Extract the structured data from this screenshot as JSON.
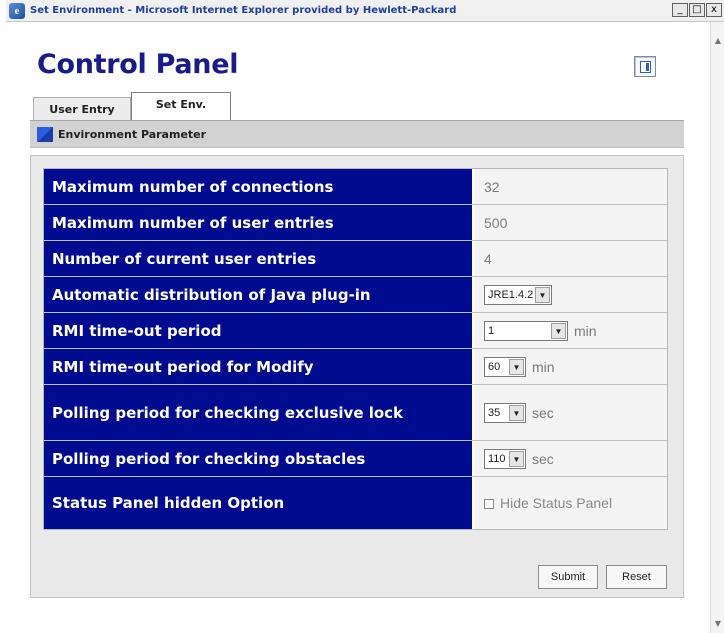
{
  "window": {
    "title": "Set Environment - Microsoft Internet Explorer provided by Hewlett-Packard",
    "min_label": "_",
    "max_label": "□",
    "close_label": "x"
  },
  "page": {
    "title": "Control Panel"
  },
  "tabs": [
    {
      "label": "User Entry",
      "active": false
    },
    {
      "label": "Set Env.",
      "active": true
    }
  ],
  "section": {
    "label": "Environment Parameter"
  },
  "settings": {
    "max_connections": {
      "label": "Maximum number of connections",
      "value": "32"
    },
    "max_user_entries": {
      "label": "Maximum number of user entries",
      "value": "500"
    },
    "current_user_entries": {
      "label": "Number of current user entries",
      "value": "4"
    },
    "java_plugin": {
      "label": "Automatic distribution of Java plug-in",
      "selected": "JRE1.4.2"
    },
    "rmi_timeout": {
      "label": "RMI time-out period",
      "selected": "1",
      "unit": "min"
    },
    "rmi_timeout_modify": {
      "label": "RMI time-out period for Modify",
      "selected": "60",
      "unit": "min"
    },
    "polling_lock": {
      "label": "Polling period for checking exclusive lock",
      "selected": "35",
      "unit": "sec"
    },
    "polling_obstacles": {
      "label": "Polling period for checking obstacles",
      "selected": "110",
      "unit": "sec"
    },
    "status_panel": {
      "label": "Status Panel hidden Option",
      "checkbox_label": "Hide Status Panel",
      "checked": false
    }
  },
  "buttons": {
    "submit": "Submit",
    "reset": "Reset"
  },
  "colors": {
    "label_bg": "#000c8f",
    "title_color": "#1a1a8a"
  }
}
